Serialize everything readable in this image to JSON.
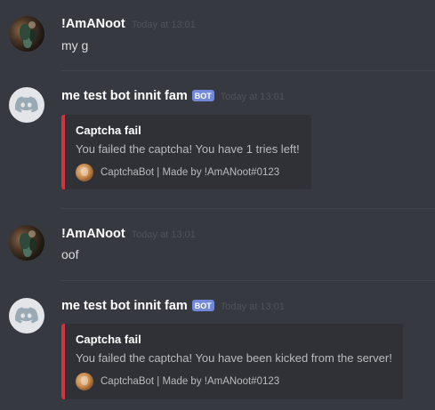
{
  "messages": [
    {
      "author": "!AmANoot",
      "timestamp": "Today at 13:01",
      "text": "my g",
      "avatar_icon": "user-avatar"
    },
    {
      "author": "me test bot innit fam",
      "bot_tag": "BOT",
      "timestamp": "Today at 13:01",
      "avatar_icon": "discord-logo-icon",
      "embed": {
        "title": "Captcha fail",
        "description": "You failed the captcha! You have 1 tries left!",
        "footer": "CaptchaBot | Made by !AmANoot#0123",
        "color": "#d0343c"
      }
    },
    {
      "author": "!AmANoot",
      "timestamp": "Today at 13:01",
      "text": "oof",
      "avatar_icon": "user-avatar"
    },
    {
      "author": "me test bot innit fam",
      "bot_tag": "BOT",
      "timestamp": "Today at 13:01",
      "avatar_icon": "discord-logo-icon",
      "embed": {
        "title": "Captcha fail",
        "description": "You failed the captcha! You have been kicked from the server!",
        "footer": "CaptchaBot | Made by !AmANoot#0123",
        "color": "#d0343c"
      }
    }
  ],
  "colors": {
    "background": "#36393f",
    "embed_background": "#2f3136",
    "bot_tag": "#7289da",
    "timestamp": "#4f535a",
    "divider": "#40444b"
  }
}
